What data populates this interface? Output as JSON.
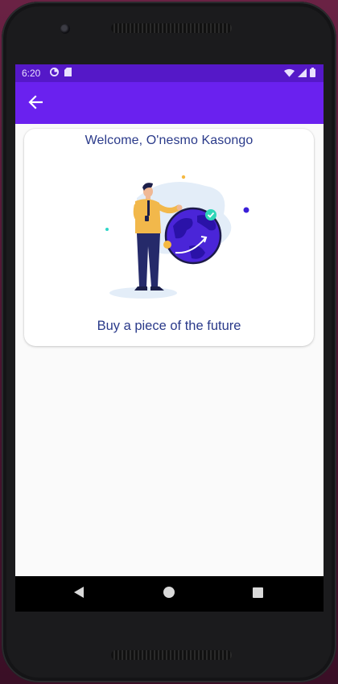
{
  "status_bar": {
    "time": "6:20",
    "icons_left": [
      "data-saver-icon",
      "sd-card-icon"
    ],
    "icons_right": [
      "wifi-icon",
      "cell-signal-icon",
      "battery-icon"
    ]
  },
  "app_bar": {
    "back_icon": "arrow-back-icon",
    "color": "#6a21ef"
  },
  "card": {
    "title": "Welcome, O'nesmo Kasongo",
    "illustration": "businessman-globe-illustration",
    "caption": "Buy a piece of the future"
  },
  "nav_bar": {
    "buttons": [
      "back-triangle-icon",
      "home-circle-icon",
      "recents-square-icon"
    ]
  },
  "colors": {
    "status_bar": "#5518c8",
    "app_bar": "#6a21ef",
    "card_text": "#2a3a8a",
    "background": "#fafafa"
  }
}
